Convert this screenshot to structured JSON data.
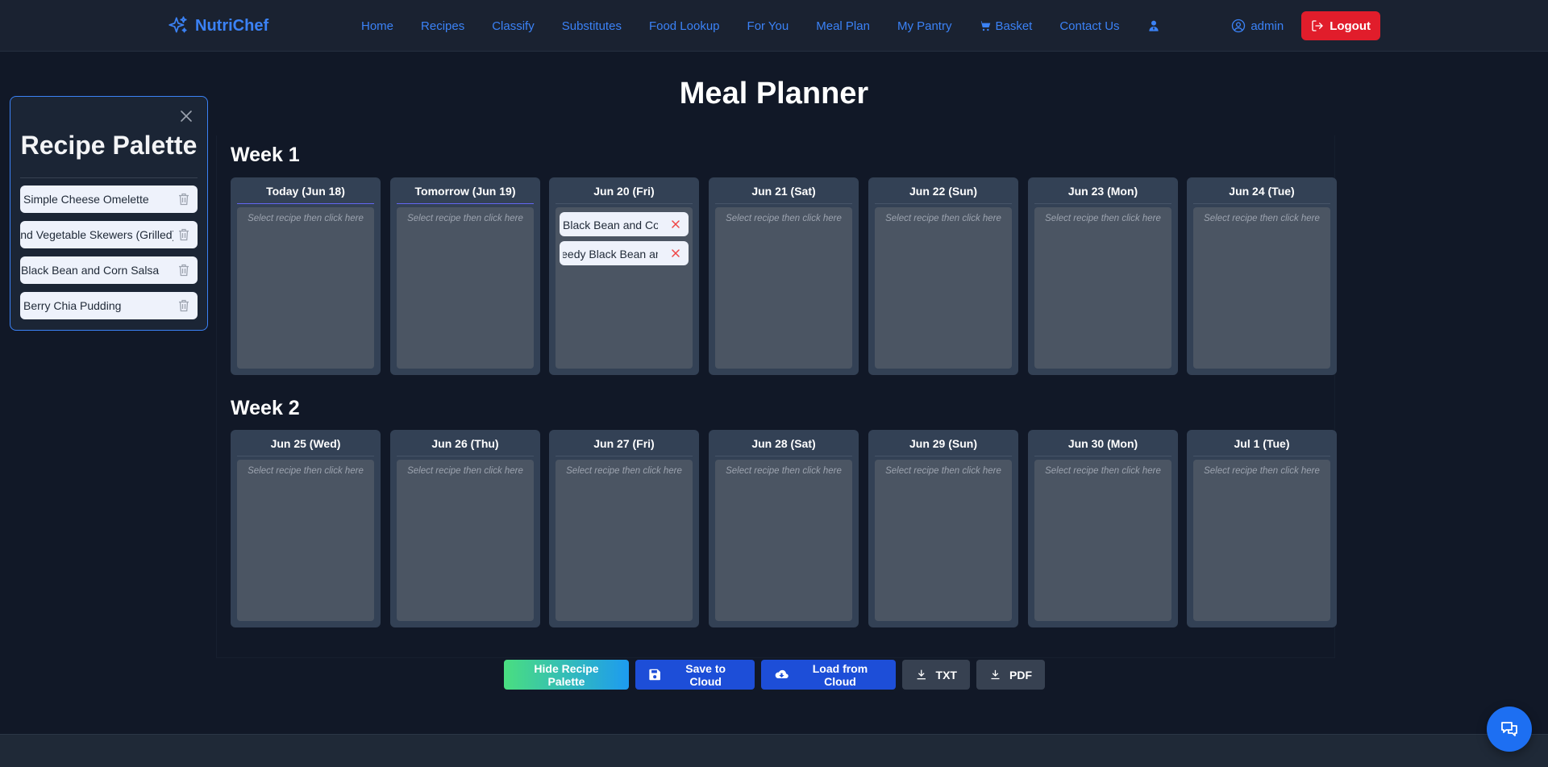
{
  "nav": {
    "brand": "NutriChef",
    "links": [
      "Home",
      "Recipes",
      "Classify",
      "Substitutes",
      "Food Lookup",
      "For You",
      "Meal Plan",
      "My Pantry",
      "Basket",
      "Contact Us"
    ],
    "user": "admin",
    "logout": "Logout",
    "colors": {
      "accent": "#3b82f6",
      "logout": "#e11d2b"
    }
  },
  "palette": {
    "title": "Recipe Palette",
    "items": [
      "Simple Cheese Omelette",
      "Chicken and Vegetable Skewers (Grilled)",
      "Black Bean and Corn Salsa",
      "Berry Chia Pudding"
    ]
  },
  "planner": {
    "title": "Meal Planner",
    "placeholder": "Select recipe then click here",
    "weeks": [
      {
        "title": "Week 1",
        "days": [
          {
            "label": "Today (Jun 18)",
            "meals": []
          },
          {
            "label": "Tomorrow (Jun 19)",
            "meals": []
          },
          {
            "label": "Jun 20 (Fri)",
            "meals": [
              "Black Bean and Corn Salsa",
              "Speedy Black Bean and"
            ]
          },
          {
            "label": "Jun 21 (Sat)",
            "meals": []
          },
          {
            "label": "Jun 22 (Sun)",
            "meals": []
          },
          {
            "label": "Jun 23 (Mon)",
            "meals": []
          },
          {
            "label": "Jun 24 (Tue)",
            "meals": []
          }
        ]
      },
      {
        "title": "Week 2",
        "days": [
          {
            "label": "Jun 25 (Wed)",
            "meals": []
          },
          {
            "label": "Jun 26 (Thu)",
            "meals": []
          },
          {
            "label": "Jun 27 (Fri)",
            "meals": []
          },
          {
            "label": "Jun 28 (Sat)",
            "meals": []
          },
          {
            "label": "Jun 29 (Sun)",
            "meals": []
          },
          {
            "label": "Jun 30 (Mon)",
            "meals": []
          },
          {
            "label": "Jul 1 (Tue)",
            "meals": []
          }
        ]
      }
    ]
  },
  "actions": {
    "hide_palette": "Hide Recipe Palette",
    "save": "Save to Cloud",
    "load": "Load from Cloud",
    "txt": "TXT",
    "pdf": "PDF"
  }
}
